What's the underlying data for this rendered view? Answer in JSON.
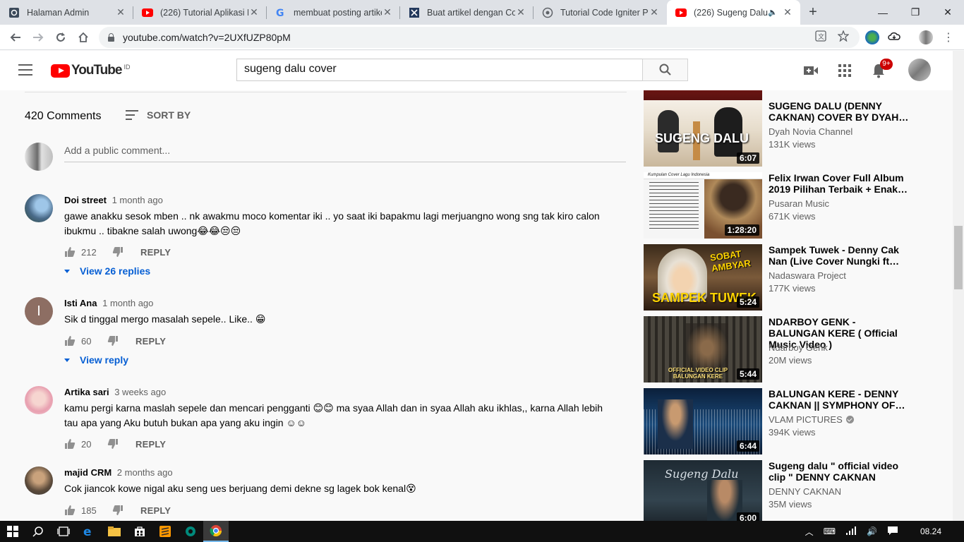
{
  "browser": {
    "tabs": [
      {
        "title": "Halaman Admin",
        "icon": "admin-icon"
      },
      {
        "title": "(226) Tutorial Aplikasi R",
        "icon": "youtube-icon"
      },
      {
        "title": "membuat posting artikel",
        "icon": "google-icon"
      },
      {
        "title": "Buat artikel dengan Co",
        "icon": "article-icon"
      },
      {
        "title": "Tutorial Code Igniter Pa",
        "icon": "globe-icon"
      },
      {
        "title": "(226) Sugeng Dalu",
        "icon": "youtube-icon",
        "active": true
      }
    ],
    "url": "youtube.com/watch?v=2UXfUZP80pM"
  },
  "masthead": {
    "logo_text": "YouTube",
    "region": "ID",
    "search_query": "sugeng dalu cover",
    "notification_count": "9+"
  },
  "comments": {
    "count_label": "420 Comments",
    "sort_label": "SORT BY",
    "add_placeholder": "Add a public comment...",
    "reply_label": "REPLY",
    "items": [
      {
        "author": "Doi street",
        "time": "1 month ago",
        "text": "gawe anakku sesok mben .. nk awakmu moco komentar iki .. yo saat iki bapakmu lagi merjuangno wong sng tak kiro calon ibukmu .. tibakne salah uwong😂😂😒😒",
        "likes": "212",
        "replies": "View 26 replies"
      },
      {
        "author": "Isti Ana",
        "initial": "I",
        "time": "1 month ago",
        "text": "Sik d tinggal mergo masalah sepele.. Like.. 😁",
        "likes": "60",
        "replies": "View reply"
      },
      {
        "author": "Artika sari",
        "time": "3 weeks ago",
        "text": "kamu pergi karna maslah sepele dan mencari pengganti 😊😊 ma syaa Allah dan in syaa Allah aku ikhlas,, karna Allah lebih tau apa yang Aku butuh bukan apa yang aku ingin ☺☺",
        "likes": "20"
      },
      {
        "author": "majid CRM",
        "time": "2 months ago",
        "text": "Cok jiancok kowe nigal aku seng ues berjuang demi dekne sg lagek bok kenal😵",
        "likes": "185"
      }
    ]
  },
  "recommendations": [
    {
      "title": "SUGENG DALU (DENNY CAKNAN) COVER BY DYAH…",
      "channel": "Dyah Novia Channel",
      "views": "131K views",
      "duration": "6:07",
      "thumb_text": "SUGENG DALU"
    },
    {
      "title": "Felix Irwan Cover Full Album 2019 Pilihan Terbaik + Enak…",
      "channel": "Pusaran Music",
      "views": "671K views",
      "duration": "1:28:20",
      "thumb_text": "Kumpulan Cover Lagu Indonesia"
    },
    {
      "title": "Sampek Tuwek - Denny Cak Nan (Live Cover Nungki ft…",
      "channel": "Nadaswara Project",
      "views": "177K views",
      "duration": "5:24",
      "thumb_text": "SAMPEK TUWEK"
    },
    {
      "title": "NDARBOY GENK - BALUNGAN KERE ( Official Music Video )",
      "channel": "Ndarboy Genk",
      "views": "20M views",
      "duration": "5:44",
      "thumb_text": "OFFICIAL VIDEO CLIP BALUNGAN KERE"
    },
    {
      "title": "BALUNGAN KERE - DENNY CAKNAN || SYMPHONY OF…",
      "channel": "VLAM PICTURES",
      "views": "394K views",
      "duration": "6:44",
      "verified": true
    },
    {
      "title": "Sugeng dalu \" official video clip \" DENNY CAKNAN",
      "channel": "DENNY CAKNAN",
      "views": "35M views",
      "duration": "6:00",
      "thumb_text": "Sugeng Dalu"
    }
  ],
  "taskbar": {
    "clock": "08.24"
  }
}
